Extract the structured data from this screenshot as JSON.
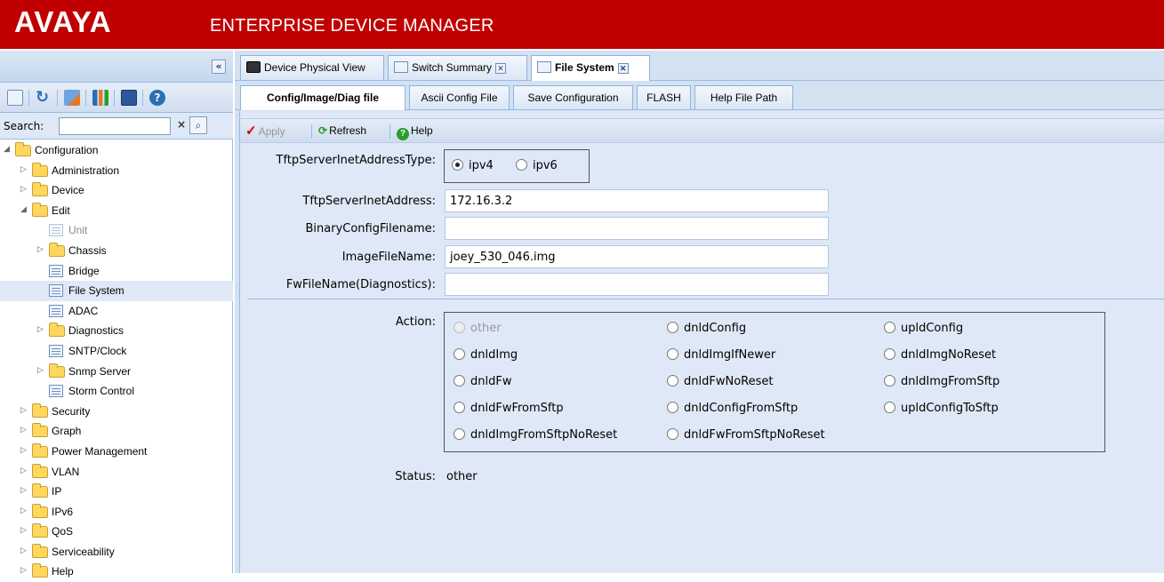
{
  "header": {
    "logo": "AVAYA",
    "title": "ENTERPRISE DEVICE MANAGER"
  },
  "left": {
    "collapse_glyph": "«",
    "toolbar_icons": [
      "select-all-icon",
      "refresh-icon",
      "edit-icon",
      "graph-icon",
      "save-icon",
      "help-icon"
    ],
    "search": {
      "label": "Search:",
      "value": "",
      "clear_glyph": "×"
    },
    "tree": [
      {
        "label": "Configuration",
        "level": 0,
        "expanded": true,
        "type": "folder"
      },
      {
        "label": "Administration",
        "level": 1,
        "expanded": false,
        "type": "folder"
      },
      {
        "label": "Device",
        "level": 1,
        "expanded": false,
        "type": "folder"
      },
      {
        "label": "Edit",
        "level": 1,
        "expanded": true,
        "type": "folder"
      },
      {
        "label": "Unit",
        "level": 2,
        "type": "leaf",
        "disabled": true
      },
      {
        "label": "Chassis",
        "level": 2,
        "expanded": false,
        "type": "folder"
      },
      {
        "label": "Bridge",
        "level": 2,
        "type": "leaf"
      },
      {
        "label": "File System",
        "level": 2,
        "type": "leaf",
        "selected": true
      },
      {
        "label": "ADAC",
        "level": 2,
        "type": "leaf"
      },
      {
        "label": "Diagnostics",
        "level": 2,
        "expanded": false,
        "type": "folder"
      },
      {
        "label": "SNTP/Clock",
        "level": 2,
        "type": "leaf"
      },
      {
        "label": "Snmp Server",
        "level": 2,
        "expanded": false,
        "type": "folder"
      },
      {
        "label": "Storm Control",
        "level": 2,
        "type": "leaf"
      },
      {
        "label": "Security",
        "level": 1,
        "expanded": false,
        "type": "folder"
      },
      {
        "label": "Graph",
        "level": 1,
        "expanded": false,
        "type": "folder"
      },
      {
        "label": "Power Management",
        "level": 1,
        "expanded": false,
        "type": "folder"
      },
      {
        "label": "VLAN",
        "level": 1,
        "expanded": false,
        "type": "folder"
      },
      {
        "label": "IP",
        "level": 1,
        "expanded": false,
        "type": "folder"
      },
      {
        "label": "IPv6",
        "level": 1,
        "expanded": false,
        "type": "folder"
      },
      {
        "label": "QoS",
        "level": 1,
        "expanded": false,
        "type": "folder"
      },
      {
        "label": "Serviceability",
        "level": 1,
        "expanded": false,
        "type": "folder"
      },
      {
        "label": "Help",
        "level": 1,
        "expanded": false,
        "type": "folder"
      }
    ]
  },
  "tabs": [
    {
      "label": "Device Physical View",
      "closable": false,
      "active": false
    },
    {
      "label": "Switch Summary",
      "closable": true,
      "active": false
    },
    {
      "label": "File System",
      "closable": true,
      "active": true
    }
  ],
  "subtabs": [
    {
      "label": "Config/Image/Diag file",
      "active": true
    },
    {
      "label": "Ascii Config File",
      "active": false
    },
    {
      "label": "Save Configuration",
      "active": false
    },
    {
      "label": "FLASH",
      "active": false
    },
    {
      "label": "Help File Path",
      "active": false
    }
  ],
  "toolbar": {
    "apply": "Apply",
    "refresh": "Refresh",
    "help": "Help"
  },
  "form": {
    "address_type_label": "TftpServerInetAddressType:",
    "address_type_options": [
      {
        "label": "ipv4",
        "selected": true
      },
      {
        "label": "ipv6",
        "selected": false
      }
    ],
    "fields": [
      {
        "label": "TftpServerInetAddress:",
        "value": "172.16.3.2"
      },
      {
        "label": "BinaryConfigFilename:",
        "value": ""
      },
      {
        "label": "ImageFileName:",
        "value": "joey_530_046.img"
      },
      {
        "label": "FwFileName(Diagnostics):",
        "value": ""
      }
    ],
    "action_label": "Action:",
    "actions": [
      {
        "label": "other",
        "disabled": true
      },
      {
        "label": "dnldConfig"
      },
      {
        "label": "upldConfig"
      },
      {
        "label": "dnldImg"
      },
      {
        "label": "dnldImgIfNewer"
      },
      {
        "label": "dnldImgNoReset"
      },
      {
        "label": "dnldFw"
      },
      {
        "label": "dnldFwNoReset"
      },
      {
        "label": "dnldImgFromSftp"
      },
      {
        "label": "dnldFwFromSftp"
      },
      {
        "label": "dnldConfigFromSftp"
      },
      {
        "label": "upldConfigToSftp"
      },
      {
        "label": "dnldImgFromSftpNoReset"
      },
      {
        "label": "dnldFwFromSftpNoReset"
      }
    ],
    "status_label": "Status:",
    "status_value": "other"
  }
}
